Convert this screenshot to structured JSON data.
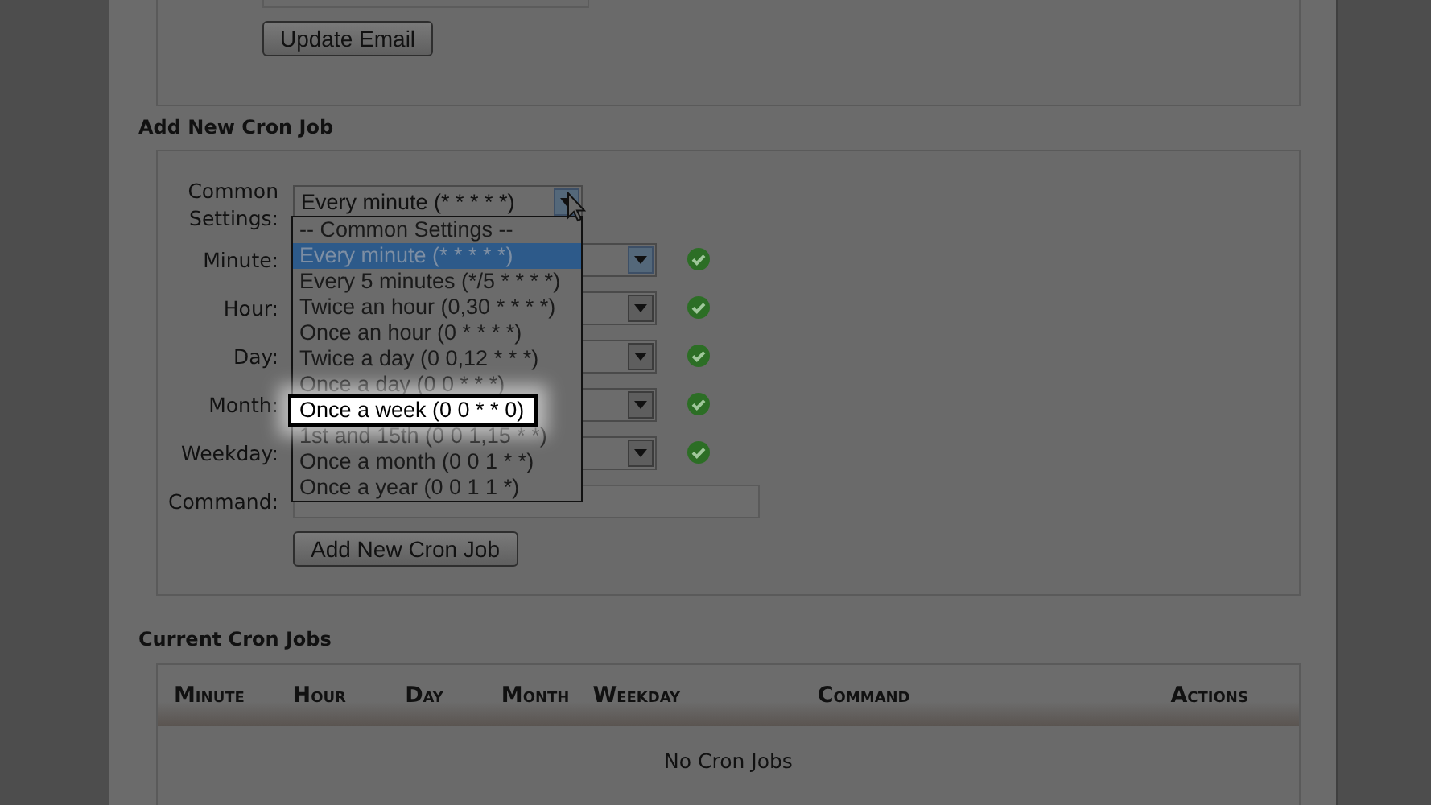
{
  "email_section": {
    "button": "Update Email"
  },
  "add_cron": {
    "heading": "Add New Cron Job",
    "common_settings": {
      "label": "Common Settings:",
      "value": "Every minute (* * * * *)",
      "expanded": true,
      "options": [
        {
          "label": "-- Common Settings --",
          "selected": false,
          "highlighted": false
        },
        {
          "label": "Every minute (* * * * *)",
          "selected": true,
          "highlighted": false
        },
        {
          "label": "Every 5 minutes (*/5 * * * *)",
          "selected": false,
          "highlighted": false
        },
        {
          "label": "Twice an hour (0,30 * * * *)",
          "selected": false,
          "highlighted": false
        },
        {
          "label": "Once an hour (0 * * * *)",
          "selected": false,
          "highlighted": false
        },
        {
          "label": "Twice a day (0 0,12 * * *)",
          "selected": false,
          "highlighted": false
        },
        {
          "label": "Once a day (0 0 * * *)",
          "selected": false,
          "highlighted": false
        },
        {
          "label": "Once a week (0 0 * * 0)",
          "selected": false,
          "highlighted": true
        },
        {
          "label": "1st and 15th (0 0 1,15 * *)",
          "selected": false,
          "highlighted": false
        },
        {
          "label": "Once a month (0 0 1 * *)",
          "selected": false,
          "highlighted": false
        },
        {
          "label": "Once a year (0 0 1 1 *)",
          "selected": false,
          "highlighted": false
        }
      ]
    },
    "fields": [
      {
        "label": "Minute:",
        "kind": "select",
        "valid": true,
        "focused": true
      },
      {
        "label": "Hour:",
        "kind": "select",
        "valid": true,
        "focused": false
      },
      {
        "label": "Day:",
        "kind": "select",
        "valid": true,
        "focused": false
      },
      {
        "label": "Month:",
        "kind": "select",
        "valid": true,
        "focused": false
      },
      {
        "label": "Weekday:",
        "kind": "select",
        "valid": true,
        "focused": false
      },
      {
        "label": "Command:",
        "kind": "text"
      }
    ],
    "button": "Add New Cron Job"
  },
  "current_cron": {
    "heading": "Current Cron Jobs",
    "columns": [
      "Minute",
      "Hour",
      "Day",
      "Month",
      "Weekday",
      "Command",
      "Actions"
    ],
    "empty_text": "No Cron Jobs"
  }
}
